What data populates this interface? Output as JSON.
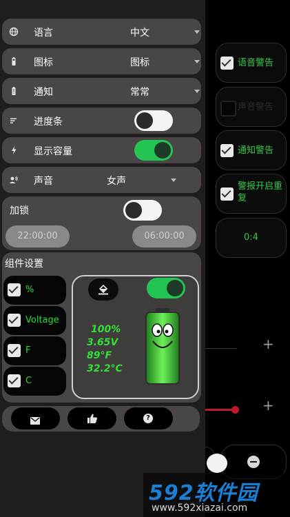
{
  "alerts": [
    {
      "label": "语音警告",
      "checked": true
    },
    {
      "label": "声音警告",
      "checked": false
    },
    {
      "label": "通知警告",
      "checked": true
    },
    {
      "label": "警报开启重复",
      "checked": true
    }
  ],
  "counter_value": "0:4",
  "plus_label": "+",
  "settings": {
    "language": {
      "label": "语言",
      "value": "中文"
    },
    "icon": {
      "label": "图标",
      "value": "图标"
    },
    "notification": {
      "label": "通知",
      "value": "常常"
    },
    "progress_bar": {
      "label": "进度条",
      "enabled": false
    },
    "show_capacity": {
      "label": "显示容量",
      "enabled": true
    },
    "voice": {
      "label": "声音",
      "value": "女声"
    }
  },
  "lock": {
    "label": "加锁",
    "enabled": false,
    "start_time": "22:00:00",
    "end_time": "06:00:00"
  },
  "widget": {
    "title": "组件设置",
    "options": [
      {
        "label": "%",
        "checked": true
      },
      {
        "label": "Voltage",
        "checked": true
      },
      {
        "label": "F",
        "checked": true
      },
      {
        "label": "C",
        "checked": true
      }
    ],
    "enabled": true,
    "preview": {
      "percent": "100%",
      "voltage": "3.65V",
      "fahrenheit": "89°F",
      "celsius": "32.2°C"
    }
  },
  "bottom_bar": [
    "mail-icon",
    "thumbs-up-icon",
    "help-icon"
  ],
  "watermark": {
    "brand": "592软件园",
    "url": "www.592xiazai.com"
  },
  "colors": {
    "accent_green": "#22c552",
    "text_green": "#33e03a",
    "slider_red": "#c0182a"
  }
}
